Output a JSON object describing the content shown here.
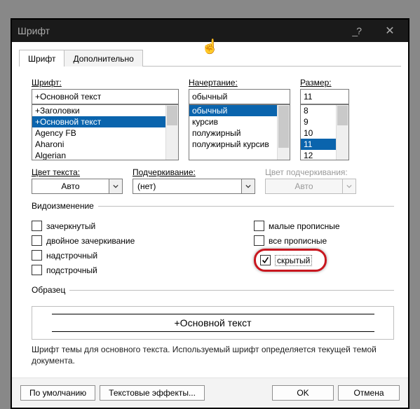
{
  "window": {
    "title": "Шрифт"
  },
  "tabs": {
    "font": "Шрифт",
    "advanced": "Дополнительно"
  },
  "labels": {
    "font": "Шрифт:",
    "style": "Начертание:",
    "size": "Размер:",
    "font_color": "Цвет текста:",
    "underline": "Подчеркивание:",
    "underline_color": "Цвет подчеркивания:",
    "effects": "Видоизменение",
    "sample": "Образец"
  },
  "font": {
    "value": "+Основной текст",
    "items": [
      "+Заголовки",
      "+Основной текст",
      "Agency FB",
      "Aharoni",
      "Algerian"
    ],
    "selected_index": 1
  },
  "style": {
    "value": "обычный",
    "items": [
      "обычный",
      "курсив",
      "полужирный",
      "полужирный курсив"
    ],
    "selected_index": 0
  },
  "size": {
    "value": "11",
    "items": [
      "8",
      "9",
      "10",
      "11",
      "12"
    ],
    "selected_index": 3
  },
  "color": {
    "value": "Авто"
  },
  "underline": {
    "value": "(нет)"
  },
  "underline_color": {
    "value": "Авто"
  },
  "effects": {
    "strike": "зачеркнутый",
    "dstrike": "двойное зачеркивание",
    "superscript": "надстрочный",
    "subscript": "подстрочный",
    "smallcaps": "малые прописные",
    "allcaps": "все прописные",
    "hidden": "скрытый"
  },
  "sample_text": "+Основной текст",
  "hint": "Шрифт темы для основного текста. Используемый шрифт определяется текущей темой документа.",
  "buttons": {
    "default": "По умолчанию",
    "text_effects": "Текстовые эффекты...",
    "ok": "OK",
    "cancel": "Отмена"
  }
}
